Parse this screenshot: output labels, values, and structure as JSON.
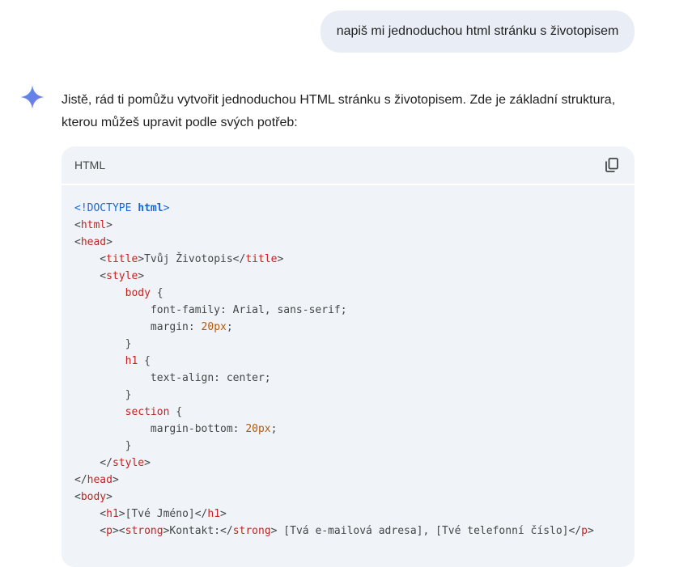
{
  "user_prompt": "napiš mi jednoduchou html stránku s životopisem",
  "response": {
    "intro_line1": "Jistě, rád ti pomůžu vytvořit jednoduchou HTML stránku s životopisem. Zde je základní struktura,",
    "intro_line2": "kterou můžeš upravit podle svých potřeb:"
  },
  "code_block": {
    "language_label": "HTML",
    "copy_icon": "copy-icon",
    "lines": [
      [
        {
          "t": "<!DOCTYPE ",
          "c": "doctype"
        },
        {
          "t": "html",
          "c": "kw"
        },
        {
          "t": ">",
          "c": "doctype"
        }
      ],
      [
        {
          "t": "<",
          "c": "punct"
        },
        {
          "t": "html",
          "c": "tag"
        },
        {
          "t": ">",
          "c": "punct"
        }
      ],
      [
        {
          "t": "<",
          "c": "punct"
        },
        {
          "t": "head",
          "c": "tag"
        },
        {
          "t": ">",
          "c": "punct"
        }
      ],
      [
        {
          "t": "    <",
          "c": "punct"
        },
        {
          "t": "title",
          "c": "tag"
        },
        {
          "t": ">Tvůj Životopis</",
          "c": "text"
        },
        {
          "t": "title",
          "c": "tag"
        },
        {
          "t": ">",
          "c": "punct"
        }
      ],
      [
        {
          "t": "    <",
          "c": "punct"
        },
        {
          "t": "style",
          "c": "tag"
        },
        {
          "t": ">",
          "c": "punct"
        }
      ],
      [
        {
          "t": "        ",
          "c": "text"
        },
        {
          "t": "body",
          "c": "tag"
        },
        {
          "t": " {",
          "c": "text"
        }
      ],
      [
        {
          "t": "            font-family: Arial, sans-serif;",
          "c": "text"
        }
      ],
      [
        {
          "t": "            margin: ",
          "c": "text"
        },
        {
          "t": "20px",
          "c": "num"
        },
        {
          "t": ";",
          "c": "text"
        }
      ],
      [
        {
          "t": "        }",
          "c": "text"
        }
      ],
      [
        {
          "t": "        ",
          "c": "text"
        },
        {
          "t": "h1",
          "c": "tag"
        },
        {
          "t": " {",
          "c": "text"
        }
      ],
      [
        {
          "t": "            text-align: center;",
          "c": "text"
        }
      ],
      [
        {
          "t": "        }",
          "c": "text"
        }
      ],
      [
        {
          "t": "        ",
          "c": "text"
        },
        {
          "t": "section",
          "c": "tag"
        },
        {
          "t": " {",
          "c": "text"
        }
      ],
      [
        {
          "t": "            margin-bottom: ",
          "c": "text"
        },
        {
          "t": "20px",
          "c": "num"
        },
        {
          "t": ";",
          "c": "text"
        }
      ],
      [
        {
          "t": "        }",
          "c": "text"
        }
      ],
      [
        {
          "t": "    </",
          "c": "punct"
        },
        {
          "t": "style",
          "c": "tag"
        },
        {
          "t": ">",
          "c": "punct"
        }
      ],
      [
        {
          "t": "</",
          "c": "punct"
        },
        {
          "t": "head",
          "c": "tag"
        },
        {
          "t": ">",
          "c": "punct"
        }
      ],
      [
        {
          "t": "<",
          "c": "punct"
        },
        {
          "t": "body",
          "c": "tag"
        },
        {
          "t": ">",
          "c": "punct"
        }
      ],
      [
        {
          "t": "    <",
          "c": "punct"
        },
        {
          "t": "h1",
          "c": "tag"
        },
        {
          "t": ">[Tvé Jméno]</",
          "c": "text"
        },
        {
          "t": "h1",
          "c": "tag"
        },
        {
          "t": ">",
          "c": "punct"
        }
      ],
      [
        {
          "t": "    <",
          "c": "punct"
        },
        {
          "t": "p",
          "c": "tag"
        },
        {
          "t": "><",
          "c": "punct"
        },
        {
          "t": "strong",
          "c": "tag"
        },
        {
          "t": ">Kontakt:</",
          "c": "text"
        },
        {
          "t": "strong",
          "c": "tag"
        },
        {
          "t": "> [Tvá e-mailová adresa], [Tvé telefonní číslo]</",
          "c": "text"
        },
        {
          "t": "p",
          "c": "tag"
        },
        {
          "t": ">",
          "c": "punct"
        }
      ]
    ]
  },
  "colors": {
    "user_bubble": "#e9eef6",
    "code_bg": "#f0f4f9",
    "tag": "#c5221f",
    "keyword": "#1967d2",
    "number": "#b55908",
    "text": "#444746"
  }
}
